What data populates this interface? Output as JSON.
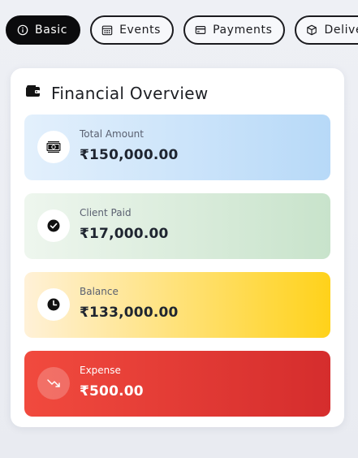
{
  "tabs": [
    {
      "label": "Basic",
      "icon": "info-icon",
      "active": true
    },
    {
      "label": "Events",
      "icon": "calendar-icon",
      "active": false
    },
    {
      "label": "Payments",
      "icon": "credit-card-icon",
      "active": false
    },
    {
      "label": "Deliverables",
      "icon": "box-icon",
      "active": false
    }
  ],
  "overview": {
    "title": "Financial Overview",
    "icon": "wallet-icon",
    "stats": [
      {
        "label": "Total Amount",
        "value": "₹150,000.00",
        "icon": "money-icon"
      },
      {
        "label": "Client Paid",
        "value": "₹17,000.00",
        "icon": "check-circle-icon"
      },
      {
        "label": "Balance",
        "value": "₹133,000.00",
        "icon": "clock-icon"
      },
      {
        "label": "Expense",
        "value": "₹500.00",
        "icon": "trend-down-icon"
      }
    ]
  },
  "colors": {
    "active_tab": "#0b0b0d",
    "total_amount_bg": "#b7d9f8",
    "client_paid_bg": "#c8e3cb",
    "balance_bg": "#ffd21a",
    "expense_bg": "#e23a35"
  }
}
